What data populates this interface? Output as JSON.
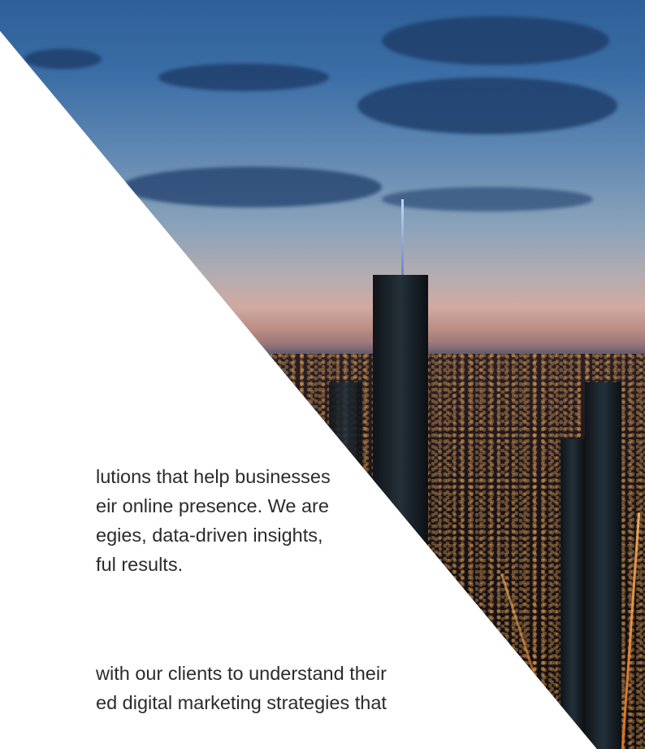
{
  "hero": {
    "image": "city-skyline-at-dusk",
    "colors": {
      "sky": "#3b6ea6",
      "dusk": "#d1aaa0",
      "city": "#16161f",
      "lights": "#ffb060"
    }
  },
  "content": {
    "paragraph_1": [
      "lutions that help businesses",
      "eir online presence. We are",
      "egies, data-driven insights,",
      "ful results."
    ],
    "paragraph_2": [
      "with our clients to understand their",
      "ed digital marketing strategies that"
    ]
  }
}
